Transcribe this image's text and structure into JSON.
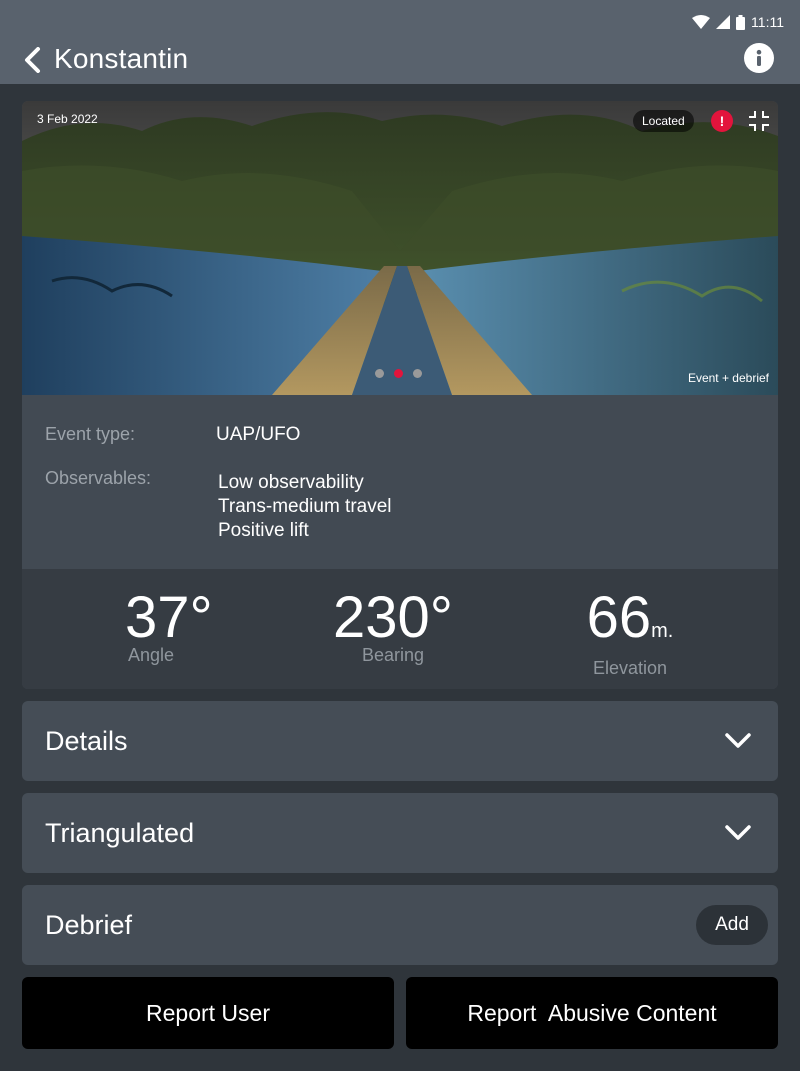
{
  "status_bar": {
    "time": "11:11"
  },
  "header": {
    "title": "Konstantin"
  },
  "event": {
    "date": "3 Feb 2022",
    "located_label": "Located",
    "alert_symbol": "!",
    "image_caption": "Event + debrief",
    "carousel": {
      "count": 3,
      "active_index": 1
    },
    "event_type_label": "Event type:",
    "event_type_value": "UAP/UFO",
    "observables_label": "Observables:",
    "observables": [
      "Low observability",
      "Trans-medium travel",
      "Positive lift"
    ]
  },
  "metrics": {
    "angle": {
      "value": "37°",
      "label": "Angle"
    },
    "bearing": {
      "value": "230°",
      "label": "Bearing"
    },
    "elevation": {
      "value": "66",
      "unit": "m.",
      "label": "Elevation"
    }
  },
  "sections": {
    "details": "Details",
    "triangulated": "Triangulated",
    "debrief": "Debrief",
    "add_label": "Add"
  },
  "actions": {
    "report_user": "Report User",
    "report_abusive": "Report  Abusive Content"
  },
  "colors": {
    "appbar": "#59626d",
    "background": "#2f353b",
    "card": "#424a53",
    "metrics_bg": "#363c43",
    "accent_red": "#e3143c"
  }
}
